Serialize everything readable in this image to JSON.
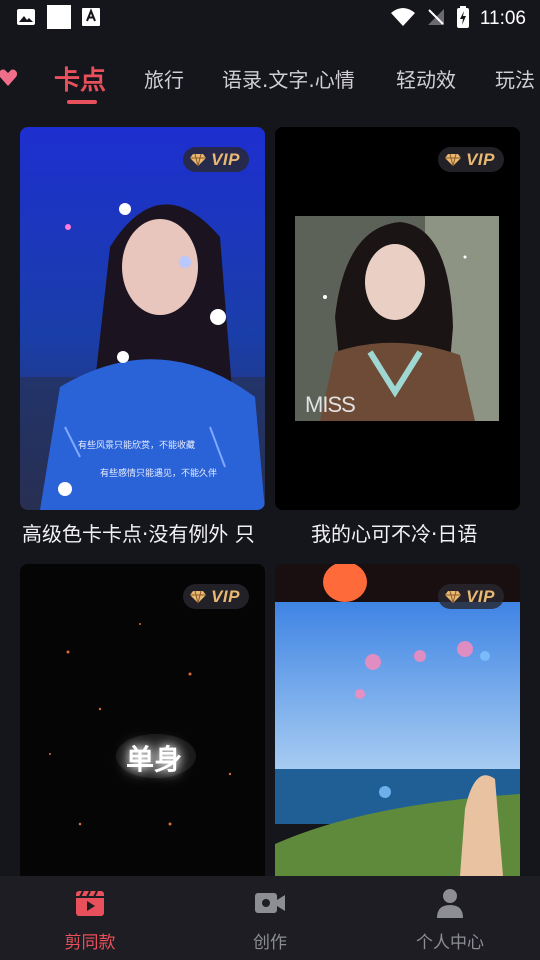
{
  "status_bar": {
    "time": "11:06"
  },
  "tabs": [
    {
      "label": "卡点",
      "active": true
    },
    {
      "label": "旅行",
      "active": false
    },
    {
      "label": "语录.文字.心情",
      "active": false
    },
    {
      "label": "轻动效",
      "active": false
    },
    {
      "label": "玩法",
      "active": false
    }
  ],
  "colors": {
    "accent": "#e8505b",
    "vip_gold": "#e9b873",
    "background": "#15151c"
  },
  "cards": [
    {
      "vip": "VIP",
      "title": "高级色卡卡点·没有例外 只",
      "overlay_lines": [
        "有些风景只能欣赏，不能收藏",
        "有些感情只能遇见，不能久伴"
      ]
    },
    {
      "vip": "VIP",
      "title": "我的心可不冷·日语",
      "overlay_text": "MISS"
    },
    {
      "vip": "VIP",
      "overlay_text": "单身"
    },
    {
      "vip": "VIP"
    }
  ],
  "bottom_nav": [
    {
      "label": "剪同款",
      "icon": "clapperboard-icon",
      "active": true
    },
    {
      "label": "创作",
      "icon": "video-camera-icon",
      "active": false
    },
    {
      "label": "个人中心",
      "icon": "person-icon",
      "active": false
    }
  ]
}
